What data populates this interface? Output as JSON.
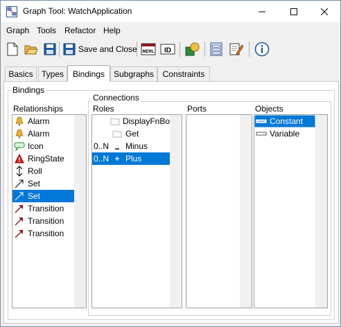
{
  "window": {
    "title": "Graph Tool: WatchApplication"
  },
  "menu": {
    "graph": "Graph",
    "tools": "Tools",
    "refactor": "Refactor",
    "help": "Help"
  },
  "toolbar": {
    "save_close_label": "Save and Close"
  },
  "tabs": [
    "Basics",
    "Types",
    "Bindings",
    "Subgraphs",
    "Constraints"
  ],
  "bindings_group_label": "Bindings",
  "connections_group_label": "Connections",
  "relationships": {
    "label": "Relationships",
    "items": [
      "Alarm",
      "Alarm",
      "Icon",
      "RingState",
      "Roll",
      "Set",
      "Set",
      "Transition",
      "Transition",
      "Transition"
    ]
  },
  "roles": {
    "label": "Roles",
    "items": [
      {
        "card": "",
        "name": "DisplayFnBo"
      },
      {
        "card": "",
        "name": "Get"
      },
      {
        "card": "0..N",
        "name": "Minus"
      },
      {
        "card": "0..N",
        "name": "Plus"
      }
    ]
  },
  "ports": {
    "label": "Ports"
  },
  "objects": {
    "label": "Objects",
    "items": [
      "Constant",
      "Variable"
    ]
  }
}
